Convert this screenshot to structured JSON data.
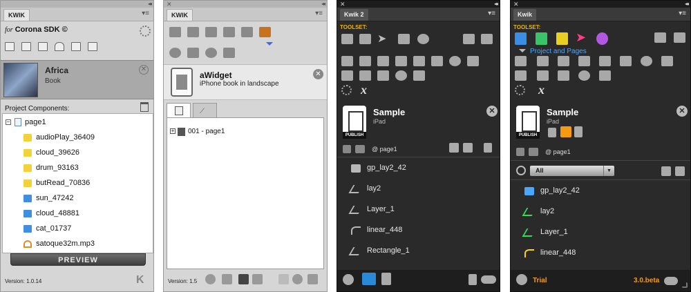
{
  "panel1": {
    "tab_label": "KWIK",
    "brand_prefix": "for",
    "brand_name": "Corona SDK ©",
    "book": {
      "title": "Africa",
      "subtitle": "Book"
    },
    "components_label": "Project Components:",
    "tree": {
      "root": "page1",
      "items": [
        {
          "label": "audioPlay_36409",
          "icon": "audio-page-icon"
        },
        {
          "label": "cloud_39626",
          "icon": "audio-page-icon"
        },
        {
          "label": "drum_93163",
          "icon": "audio-page-icon"
        },
        {
          "label": "butRead_70836",
          "icon": "audio-page-icon"
        },
        {
          "label": "sun_47242",
          "icon": "image-icon"
        },
        {
          "label": "cloud_48881",
          "icon": "image-icon"
        },
        {
          "label": "cat_01737",
          "icon": "image-icon"
        },
        {
          "label": "satoque32m.mp3",
          "icon": "headphones-icon"
        }
      ]
    },
    "preview_label": "PREVIEW",
    "version": "Version: 1.0.14"
  },
  "panel2": {
    "tab_label": "KWIK",
    "widget": {
      "title": "aWidget",
      "subtitle": "iPhone book in landscape"
    },
    "page_row": "001 - page1",
    "version": "Version: 1.5"
  },
  "panel3": {
    "tab_label": "Kwik 2",
    "toolset_label": "TOOLSET:",
    "project": {
      "title": "Sample",
      "subtitle": "iPad",
      "publish": "PUBLISH"
    },
    "page_label": "@ page1",
    "layers": [
      "gp_lay2_42",
      "lay2",
      "Layer_1",
      "linear_448",
      "Rectangle_1"
    ]
  },
  "panel4": {
    "tab_label": "Kwik",
    "toolset_label": "TOOLSET:",
    "toolset_title": "Project and Pages",
    "project": {
      "title": "Sample",
      "subtitle": "iPad",
      "publish": "PUBLISH"
    },
    "page_label": "@ page1",
    "filter_value": "All",
    "layers": [
      "gp_lay2_42",
      "lay2",
      "Layer_1",
      "linear_448"
    ],
    "trial_label": "Trial",
    "version_label": "3.0.beta"
  },
  "colors": {
    "accent_orange": "#f39c12",
    "accent_blue": "#4aa6ff",
    "layer_green": "#33dd55",
    "layer_yellow": "#ffd400"
  }
}
